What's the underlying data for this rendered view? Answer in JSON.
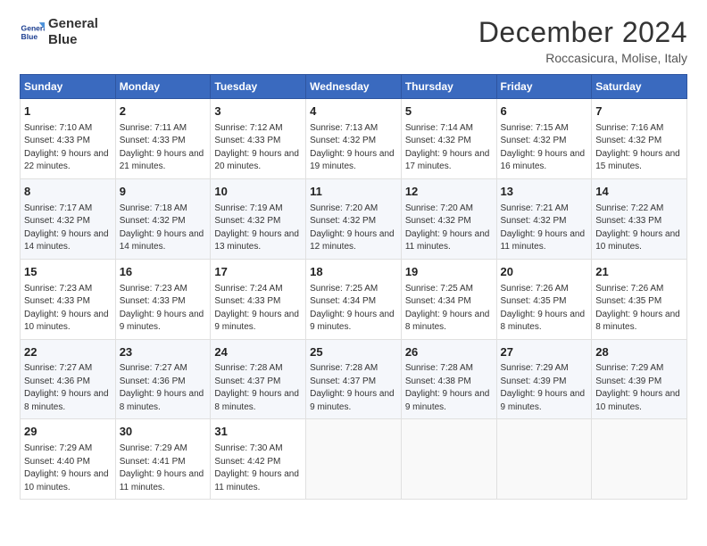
{
  "logo": {
    "line1": "General",
    "line2": "Blue"
  },
  "title": "December 2024",
  "location": "Roccasicura, Molise, Italy",
  "weekdays": [
    "Sunday",
    "Monday",
    "Tuesday",
    "Wednesday",
    "Thursday",
    "Friday",
    "Saturday"
  ],
  "weeks": [
    [
      {
        "day": "1",
        "sunrise": "Sunrise: 7:10 AM",
        "sunset": "Sunset: 4:33 PM",
        "daylight": "Daylight: 9 hours and 22 minutes."
      },
      {
        "day": "2",
        "sunrise": "Sunrise: 7:11 AM",
        "sunset": "Sunset: 4:33 PM",
        "daylight": "Daylight: 9 hours and 21 minutes."
      },
      {
        "day": "3",
        "sunrise": "Sunrise: 7:12 AM",
        "sunset": "Sunset: 4:33 PM",
        "daylight": "Daylight: 9 hours and 20 minutes."
      },
      {
        "day": "4",
        "sunrise": "Sunrise: 7:13 AM",
        "sunset": "Sunset: 4:32 PM",
        "daylight": "Daylight: 9 hours and 19 minutes."
      },
      {
        "day": "5",
        "sunrise": "Sunrise: 7:14 AM",
        "sunset": "Sunset: 4:32 PM",
        "daylight": "Daylight: 9 hours and 17 minutes."
      },
      {
        "day": "6",
        "sunrise": "Sunrise: 7:15 AM",
        "sunset": "Sunset: 4:32 PM",
        "daylight": "Daylight: 9 hours and 16 minutes."
      },
      {
        "day": "7",
        "sunrise": "Sunrise: 7:16 AM",
        "sunset": "Sunset: 4:32 PM",
        "daylight": "Daylight: 9 hours and 15 minutes."
      }
    ],
    [
      {
        "day": "8",
        "sunrise": "Sunrise: 7:17 AM",
        "sunset": "Sunset: 4:32 PM",
        "daylight": "Daylight: 9 hours and 14 minutes."
      },
      {
        "day": "9",
        "sunrise": "Sunrise: 7:18 AM",
        "sunset": "Sunset: 4:32 PM",
        "daylight": "Daylight: 9 hours and 14 minutes."
      },
      {
        "day": "10",
        "sunrise": "Sunrise: 7:19 AM",
        "sunset": "Sunset: 4:32 PM",
        "daylight": "Daylight: 9 hours and 13 minutes."
      },
      {
        "day": "11",
        "sunrise": "Sunrise: 7:20 AM",
        "sunset": "Sunset: 4:32 PM",
        "daylight": "Daylight: 9 hours and 12 minutes."
      },
      {
        "day": "12",
        "sunrise": "Sunrise: 7:20 AM",
        "sunset": "Sunset: 4:32 PM",
        "daylight": "Daylight: 9 hours and 11 minutes."
      },
      {
        "day": "13",
        "sunrise": "Sunrise: 7:21 AM",
        "sunset": "Sunset: 4:32 PM",
        "daylight": "Daylight: 9 hours and 11 minutes."
      },
      {
        "day": "14",
        "sunrise": "Sunrise: 7:22 AM",
        "sunset": "Sunset: 4:33 PM",
        "daylight": "Daylight: 9 hours and 10 minutes."
      }
    ],
    [
      {
        "day": "15",
        "sunrise": "Sunrise: 7:23 AM",
        "sunset": "Sunset: 4:33 PM",
        "daylight": "Daylight: 9 hours and 10 minutes."
      },
      {
        "day": "16",
        "sunrise": "Sunrise: 7:23 AM",
        "sunset": "Sunset: 4:33 PM",
        "daylight": "Daylight: 9 hours and 9 minutes."
      },
      {
        "day": "17",
        "sunrise": "Sunrise: 7:24 AM",
        "sunset": "Sunset: 4:33 PM",
        "daylight": "Daylight: 9 hours and 9 minutes."
      },
      {
        "day": "18",
        "sunrise": "Sunrise: 7:25 AM",
        "sunset": "Sunset: 4:34 PM",
        "daylight": "Daylight: 9 hours and 9 minutes."
      },
      {
        "day": "19",
        "sunrise": "Sunrise: 7:25 AM",
        "sunset": "Sunset: 4:34 PM",
        "daylight": "Daylight: 9 hours and 8 minutes."
      },
      {
        "day": "20",
        "sunrise": "Sunrise: 7:26 AM",
        "sunset": "Sunset: 4:35 PM",
        "daylight": "Daylight: 9 hours and 8 minutes."
      },
      {
        "day": "21",
        "sunrise": "Sunrise: 7:26 AM",
        "sunset": "Sunset: 4:35 PM",
        "daylight": "Daylight: 9 hours and 8 minutes."
      }
    ],
    [
      {
        "day": "22",
        "sunrise": "Sunrise: 7:27 AM",
        "sunset": "Sunset: 4:36 PM",
        "daylight": "Daylight: 9 hours and 8 minutes."
      },
      {
        "day": "23",
        "sunrise": "Sunrise: 7:27 AM",
        "sunset": "Sunset: 4:36 PM",
        "daylight": "Daylight: 9 hours and 8 minutes."
      },
      {
        "day": "24",
        "sunrise": "Sunrise: 7:28 AM",
        "sunset": "Sunset: 4:37 PM",
        "daylight": "Daylight: 9 hours and 8 minutes."
      },
      {
        "day": "25",
        "sunrise": "Sunrise: 7:28 AM",
        "sunset": "Sunset: 4:37 PM",
        "daylight": "Daylight: 9 hours and 9 minutes."
      },
      {
        "day": "26",
        "sunrise": "Sunrise: 7:28 AM",
        "sunset": "Sunset: 4:38 PM",
        "daylight": "Daylight: 9 hours and 9 minutes."
      },
      {
        "day": "27",
        "sunrise": "Sunrise: 7:29 AM",
        "sunset": "Sunset: 4:39 PM",
        "daylight": "Daylight: 9 hours and 9 minutes."
      },
      {
        "day": "28",
        "sunrise": "Sunrise: 7:29 AM",
        "sunset": "Sunset: 4:39 PM",
        "daylight": "Daylight: 9 hours and 10 minutes."
      }
    ],
    [
      {
        "day": "29",
        "sunrise": "Sunrise: 7:29 AM",
        "sunset": "Sunset: 4:40 PM",
        "daylight": "Daylight: 9 hours and 10 minutes."
      },
      {
        "day": "30",
        "sunrise": "Sunrise: 7:29 AM",
        "sunset": "Sunset: 4:41 PM",
        "daylight": "Daylight: 9 hours and 11 minutes."
      },
      {
        "day": "31",
        "sunrise": "Sunrise: 7:30 AM",
        "sunset": "Sunset: 4:42 PM",
        "daylight": "Daylight: 9 hours and 11 minutes."
      },
      null,
      null,
      null,
      null
    ]
  ]
}
